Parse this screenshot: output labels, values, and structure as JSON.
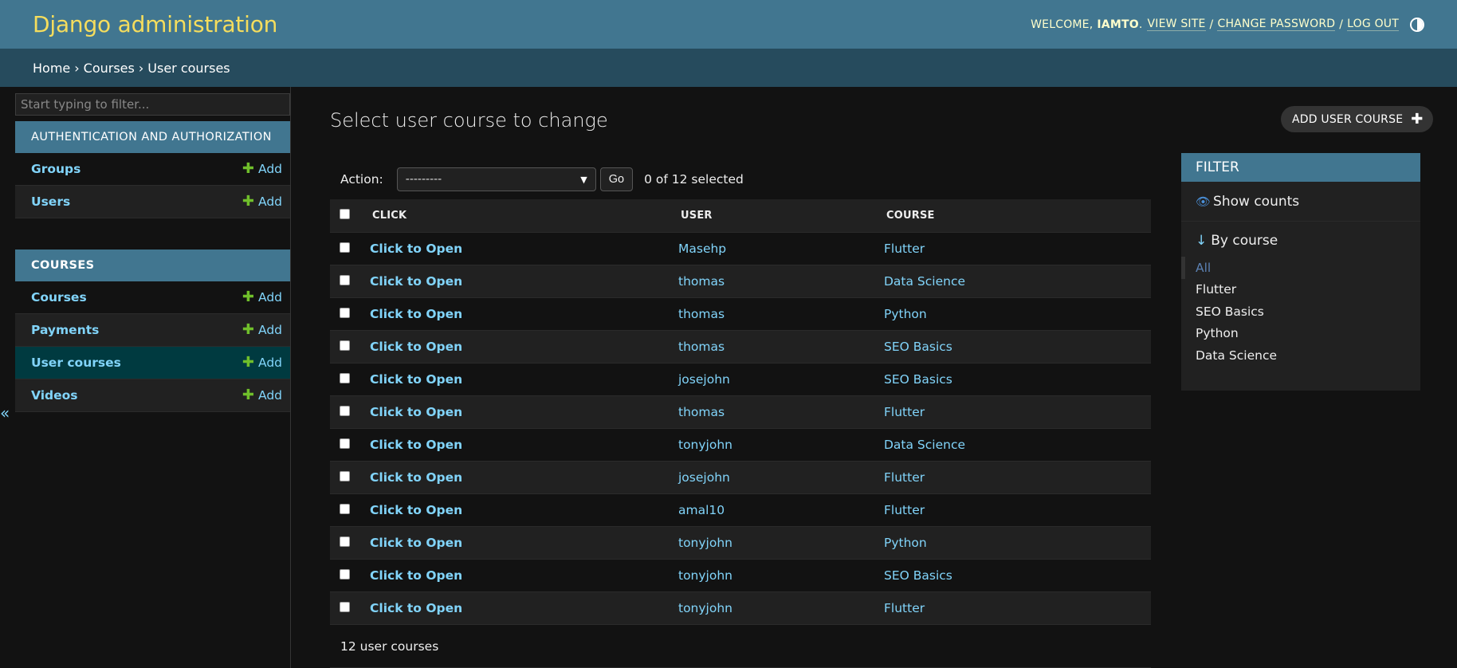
{
  "header": {
    "brand": "Django administration",
    "welcome": "Welcome,",
    "username": "iamto",
    "view_site": "View site",
    "change_password": "Change password",
    "log_out": "Log out",
    "separator": "/"
  },
  "breadcrumbs": {
    "home": "Home",
    "app": "Courses",
    "current": "User courses",
    "arrow": "›"
  },
  "sidebar": {
    "filter_placeholder": "Start typing to filter...",
    "collapse_glyph": "«",
    "modules": [
      {
        "caption": "Authentication and Authorization",
        "models": [
          {
            "name": "Groups",
            "add": "Add"
          },
          {
            "name": "Users",
            "add": "Add"
          }
        ]
      },
      {
        "caption": "Courses",
        "models": [
          {
            "name": "Courses",
            "add": "Add"
          },
          {
            "name": "Payments",
            "add": "Add"
          },
          {
            "name": "User courses",
            "add": "Add",
            "current": true
          },
          {
            "name": "Videos",
            "add": "Add"
          }
        ]
      }
    ]
  },
  "content": {
    "title": "Select user course to change",
    "add_button": "Add user course",
    "action_label": "Action:",
    "action_value": "---------",
    "go_label": "Go",
    "selected_count": "0 of 12 selected",
    "paginator": "12 user courses"
  },
  "table": {
    "columns": [
      "Click",
      "User",
      "Course"
    ],
    "rows": [
      {
        "click": "Click to Open",
        "user": "Masehp",
        "course": "Flutter"
      },
      {
        "click": "Click to Open",
        "user": "thomas",
        "course": "Data Science"
      },
      {
        "click": "Click to Open",
        "user": "thomas",
        "course": "Python"
      },
      {
        "click": "Click to Open",
        "user": "thomas",
        "course": "SEO Basics"
      },
      {
        "click": "Click to Open",
        "user": "josejohn",
        "course": "SEO Basics"
      },
      {
        "click": "Click to Open",
        "user": "thomas",
        "course": "Flutter"
      },
      {
        "click": "Click to Open",
        "user": "tonyjohn",
        "course": "Data Science"
      },
      {
        "click": "Click to Open",
        "user": "josejohn",
        "course": "Flutter"
      },
      {
        "click": "Click to Open",
        "user": "amal10",
        "course": "Flutter"
      },
      {
        "click": "Click to Open",
        "user": "tonyjohn",
        "course": "Python"
      },
      {
        "click": "Click to Open",
        "user": "tonyjohn",
        "course": "SEO Basics"
      },
      {
        "click": "Click to Open",
        "user": "tonyjohn",
        "course": "Flutter"
      }
    ]
  },
  "filter": {
    "title": "Filter",
    "show_counts": "Show counts",
    "by_course": "By course",
    "options": [
      "All",
      "Flutter",
      "SEO Basics",
      "Python",
      "Data Science"
    ],
    "selected_option": "All"
  },
  "colors": {
    "header_bg": "#417690",
    "brand": "#f5dd5d",
    "breadcrumbs_bg": "#264b5d",
    "link": "#81d4fa",
    "add_plus": "#70bf2b",
    "current_model_bg": "#003a40"
  },
  "icons": {
    "theme_toggle": "half-circle-icon",
    "plus": "plus-icon",
    "eye": "eye-icon",
    "down_arrow": "arrow-down-icon",
    "collapse": "double-chevron-left-icon"
  }
}
